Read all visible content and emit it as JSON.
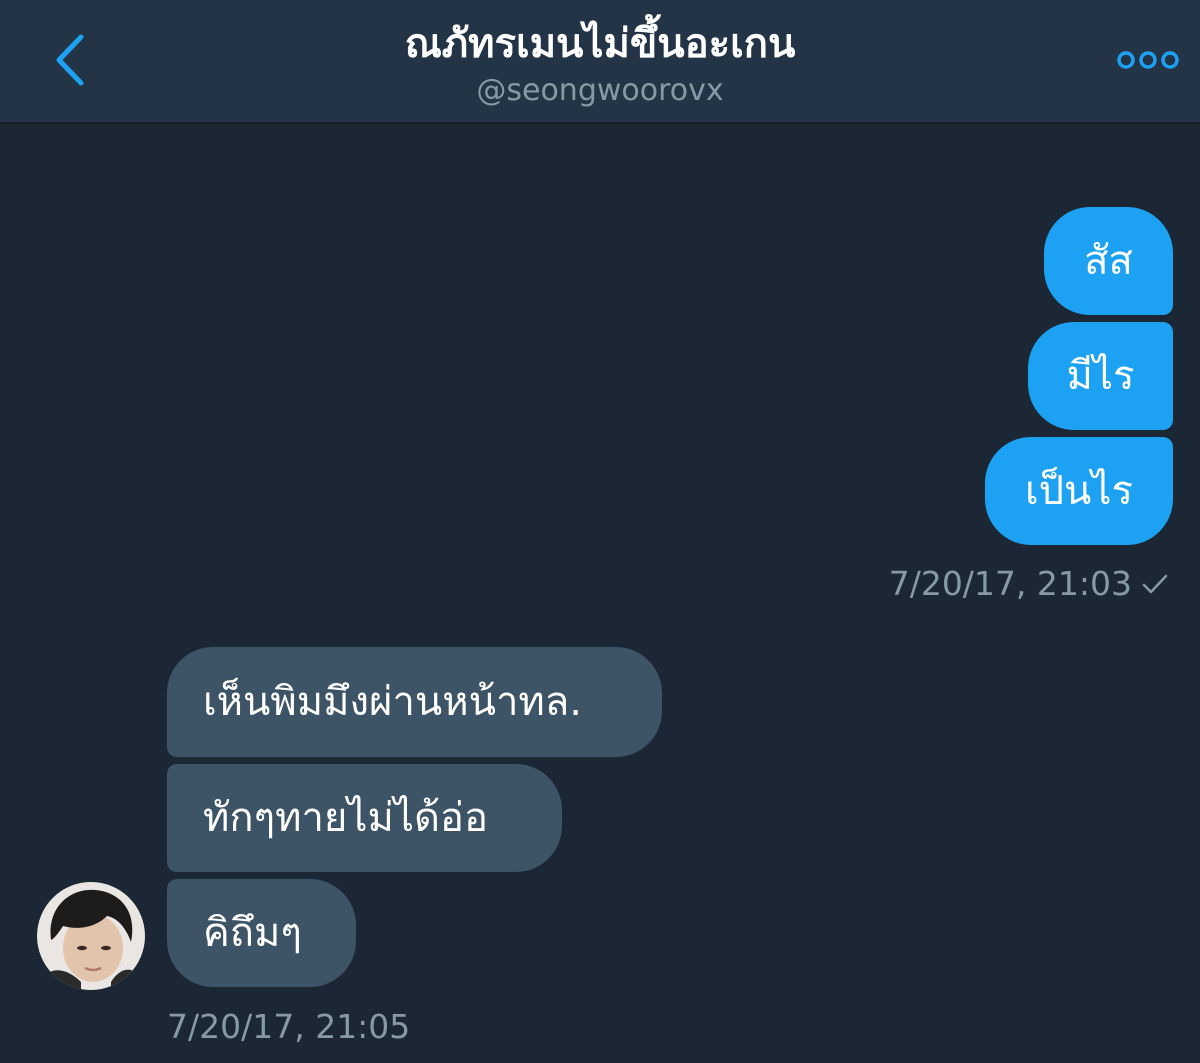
{
  "header": {
    "title": "ณภัทรเมนไม่ขึ้นอะเกน",
    "handle": "@seongwoorovx",
    "back_icon": "chevron-left-icon",
    "more_icon": "more-dots-icon"
  },
  "messages": {
    "sent": [
      {
        "text": "สัส"
      },
      {
        "text": "มีไร"
      },
      {
        "text": "เป็นไร"
      }
    ],
    "sent_timestamp": "7/20/17, 21:03",
    "sent_status_icon": "checkmark-icon",
    "received": [
      {
        "text": "เห็นพิมมึงผ่านหน้าทล."
      },
      {
        "text": "ทักๆทายไม่ได้อ่อ"
      },
      {
        "text": "คิถึมๆ"
      }
    ],
    "received_timestamp": "7/20/17, 21:05"
  },
  "colors": {
    "background": "#1c2735",
    "header": "#243447",
    "accent": "#1da1f2",
    "received_bubble": "#3d5466",
    "muted_text": "#8899a6"
  }
}
